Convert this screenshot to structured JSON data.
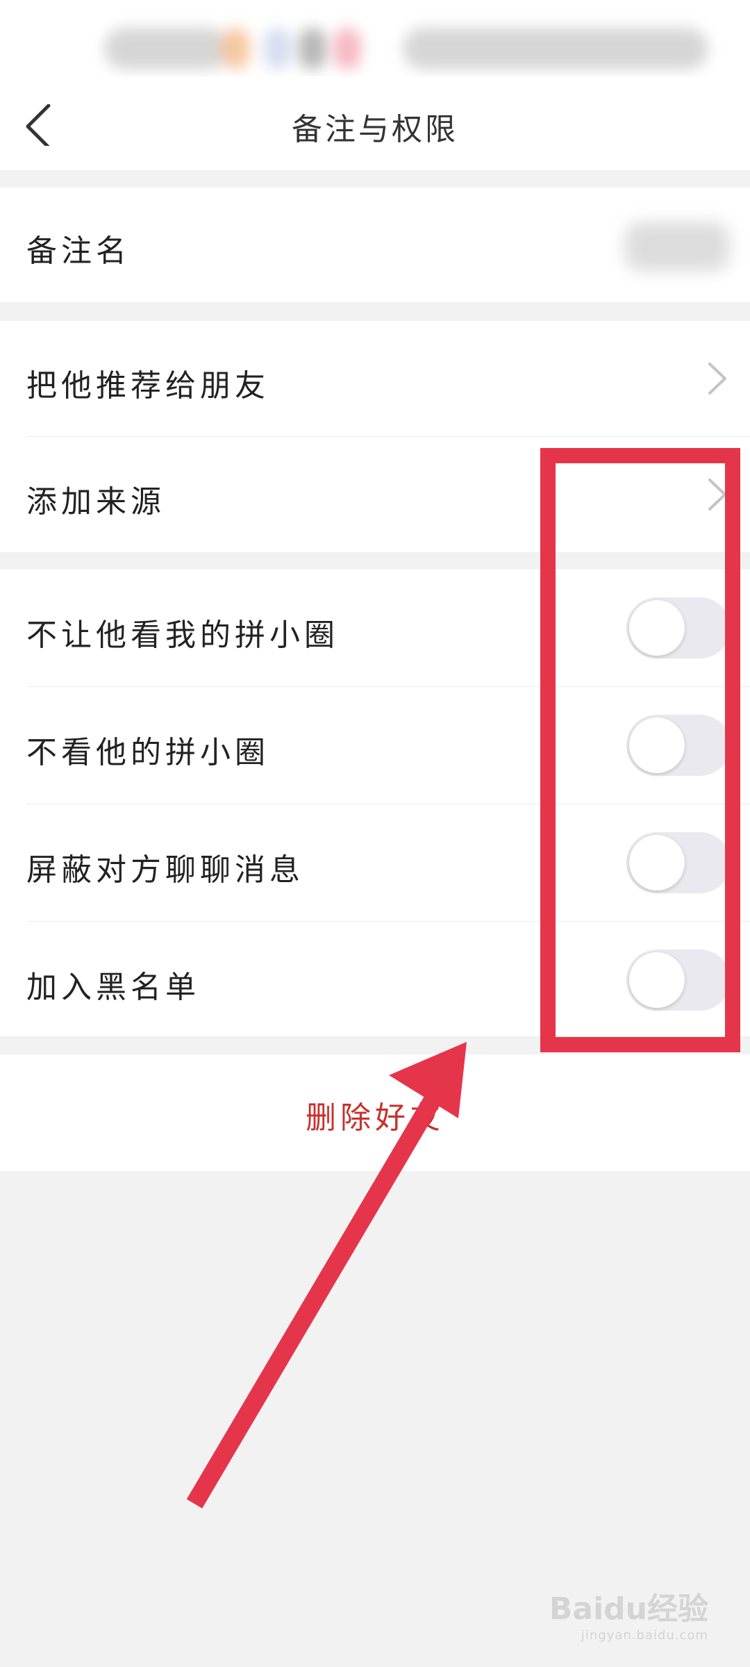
{
  "nav": {
    "title": "备注与权限"
  },
  "sections": {
    "remark": {
      "label": "备注名"
    },
    "links": [
      {
        "label": "把他推荐给朋友"
      },
      {
        "label": "添加来源"
      }
    ],
    "toggles": [
      {
        "label": "不让他看我的拼小圈",
        "on": false
      },
      {
        "label": "不看他的拼小圈",
        "on": false
      },
      {
        "label": "屏蔽对方聊聊消息",
        "on": false
      },
      {
        "label": "加入黑名单",
        "on": false
      }
    ]
  },
  "delete_button": {
    "label": "删除好友"
  },
  "icons": {
    "back": "chevron-left-icon",
    "row_chevron": "chevron-right-icon"
  },
  "colors": {
    "accent_red": "#c8302c",
    "annotation_red": "#e5354b",
    "toggle_off_track": "#e9e9ef",
    "background": "#f2f2f2"
  },
  "watermark": {
    "main": "Baidu经验",
    "sub": "jingyan.baidu.com"
  }
}
